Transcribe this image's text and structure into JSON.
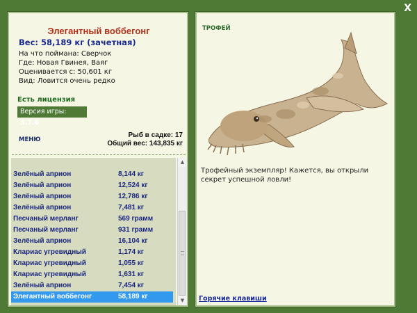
{
  "window": {
    "close_label": "X"
  },
  "left": {
    "fish_name": "Элегантный воббегонг",
    "weight_line": "Вес: 58,189 кг (зачетная)",
    "bait": "На что поймана: Сверчок",
    "location": "Где: Новая Гвинея, Ваяг",
    "valued_from": "Оценивается с: 50,601 кг",
    "rarity": "Вид: Ловится очень редко",
    "license": "Есть лицензия",
    "version_label": "Версия игры:",
    "version_value": "3.7.6",
    "menu_label": "МЕНЮ",
    "stats_count": "Рыб в садке: 17",
    "stats_total": "Общий вес: 143,835 кг"
  },
  "catch_list": [
    {
      "name": "Зелёный априон",
      "weight": "8,144 кг"
    },
    {
      "name": "Зелёный априон",
      "weight": "12,524 кг"
    },
    {
      "name": "Зелёный априон",
      "weight": "12,786 кг"
    },
    {
      "name": "Зелёный априон",
      "weight": "7,481 кг"
    },
    {
      "name": "Песчаный мерланг",
      "weight": "569 грамм"
    },
    {
      "name": "Песчаный мерланг",
      "weight": "931 грамм"
    },
    {
      "name": "Зелёный априон",
      "weight": "16,104 кг"
    },
    {
      "name": "Клариас угревидный",
      "weight": "1,174 кг"
    },
    {
      "name": "Клариас угревидный",
      "weight": "1,055 кг"
    },
    {
      "name": "Клариас угревидный",
      "weight": "1,631 кг"
    },
    {
      "name": "Зелёный априон",
      "weight": "7,454 кг"
    },
    {
      "name": "Элегантный воббегонг",
      "weight": "58,189 кг",
      "selected": true
    }
  ],
  "right": {
    "trophy_label": "ТРОФЕЙ",
    "trophy_text": "Трофейный экземпляр! Кажется, вы открыли секрет успешной ловли!",
    "hotkeys_label": "Горячие клавиши"
  },
  "colors": {
    "frame": "#4f7a36",
    "panel": "#f6f6e4",
    "title_red": "#b3321b",
    "link_blue": "#1a2b9c",
    "selection": "#3399ee"
  }
}
